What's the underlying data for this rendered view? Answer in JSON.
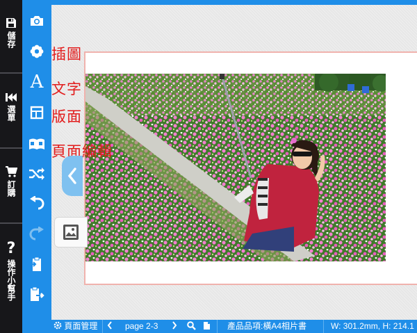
{
  "leftbar": {
    "items": [
      {
        "label": "儲存",
        "icon": "save-icon"
      },
      {
        "label": "選單",
        "icon": "rewind-icon"
      },
      {
        "label": "訂購",
        "icon": "cart-icon"
      },
      {
        "label": "操作小幫手",
        "icon": "question-icon"
      }
    ]
  },
  "toolbar": {
    "tools": [
      "camera-icon",
      "flower-icon",
      "text-icon",
      "layout-icon",
      "book-icon",
      "shuffle-icon",
      "undo-icon",
      "redo-icon",
      "clipboard-paste-icon",
      "clipboard-export-icon"
    ]
  },
  "menu": {
    "illustration": "插圖",
    "text": "文字",
    "layout": "版面",
    "page_edit": "頁面編輯"
  },
  "statusbar": {
    "page_manage": "頁面管理",
    "page_indicator": "page 2-3",
    "product": "產品品項:橫A4相片書",
    "dimensions": "W: 301.2mm, H: 214.1"
  },
  "colors": {
    "toolbar_blue": "#1f8ee8",
    "menu_red": "#e21b1b",
    "leftbar_dark": "#17171a"
  }
}
